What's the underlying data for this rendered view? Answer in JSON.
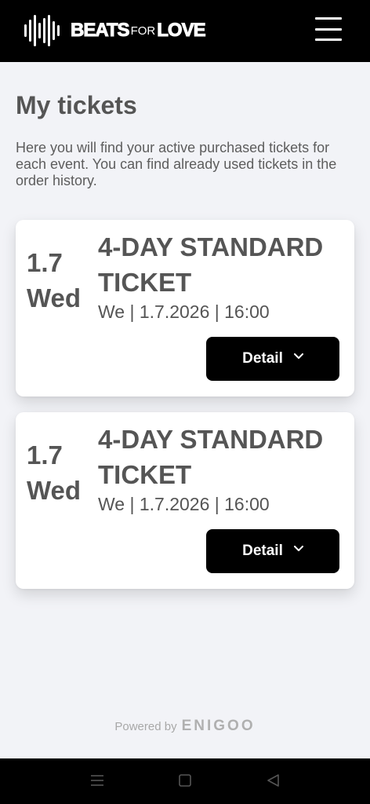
{
  "header": {
    "brand_part1": "BEATS",
    "brand_part2": "FOR",
    "brand_part3": "LOVE",
    "logo_icon": "soundwave-icon",
    "menu_icon": "hamburger-menu-icon"
  },
  "page": {
    "title": "My tickets",
    "intro": "Here you will find your active purchased tickets for each event. You can find already used tickets in the order history."
  },
  "tickets": [
    {
      "date": "1.7",
      "day": "Wed",
      "name": "4-DAY STANDARD TICKET",
      "meta": "We | 1.7.2026 | 16:00",
      "detail_label": "Detail"
    },
    {
      "date": "1.7",
      "day": "Wed",
      "name": "4-DAY STANDARD TICKET",
      "meta": "We | 1.7.2026 | 16:00",
      "detail_label": "Detail"
    }
  ],
  "footer": {
    "powered_by": "Powered by",
    "provider": "ENIGOO"
  },
  "colors": {
    "header_bg": "#000000",
    "page_bg": "#f2f3f7",
    "card_bg": "#ffffff",
    "button_bg": "#000000",
    "text": "#555555"
  }
}
